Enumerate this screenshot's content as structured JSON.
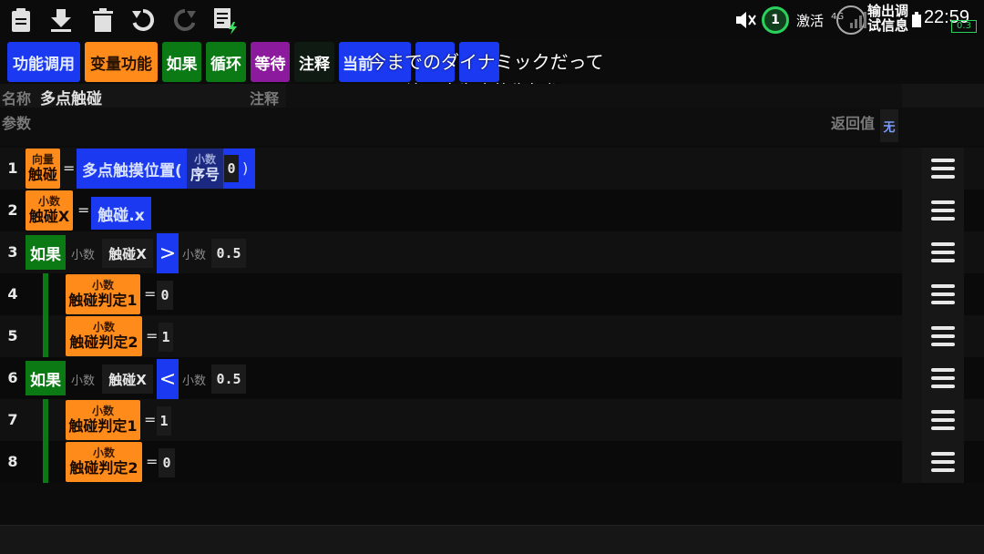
{
  "status_bar": {
    "badge": "1",
    "time": "22:59",
    "network": "4G",
    "left_label": "激活",
    "debug_label_1": "输出调",
    "debug_label_2": "试信息",
    "battery": "0.3"
  },
  "categories": [
    {
      "label": "功能调用",
      "color": "blue"
    },
    {
      "label": "变量功能",
      "color": "orange"
    },
    {
      "label": "如果",
      "color": "green"
    },
    {
      "label": "循环",
      "color": "green"
    },
    {
      "label": "等待",
      "color": "purple"
    },
    {
      "label": "注释",
      "color": "dark"
    },
    {
      "label": "当前",
      "color": "blue"
    },
    {
      "label": "",
      "color": "blue"
    },
    {
      "label": "",
      "color": "blue"
    }
  ],
  "overlay": {
    "line1": "今までのダイナミックだって",
    "line2": "连至今为止的生机都"
  },
  "meta": {
    "name_label": "名称",
    "name_value": "多点触碰",
    "comment_label": "注释",
    "params_label": "参数",
    "return_label": "返回值",
    "return_value": "无"
  },
  "rows": [
    {
      "num": "1",
      "var_type": "向量",
      "var_name": "触碰",
      "eq": "=",
      "func": "多点触摸位置(",
      "arg_type": "小数",
      "arg_name": "序号",
      "arg_value": "0",
      "close": ")"
    },
    {
      "num": "2",
      "var_type": "小数",
      "var_name": "触碰X",
      "eq": "=",
      "expr": "触碰.x"
    },
    {
      "num": "3",
      "if_label": "如果",
      "left_type": "小数",
      "left_name": "触碰X",
      "op": ">",
      "right_type": "小数",
      "right_value": "0.5"
    },
    {
      "num": "4",
      "var_type": "小数",
      "var_name": "触碰判定1",
      "eq": "=",
      "value": "0"
    },
    {
      "num": "5",
      "var_type": "小数",
      "var_name": "触碰判定2",
      "eq": "=",
      "value": "1"
    },
    {
      "num": "6",
      "if_label": "如果",
      "left_type": "小数",
      "left_name": "触碰X",
      "op": "<",
      "right_type": "小数",
      "right_value": "0.5"
    },
    {
      "num": "7",
      "var_type": "小数",
      "var_name": "触碰判定1",
      "eq": "=",
      "value": "1"
    },
    {
      "num": "8",
      "var_type": "小数",
      "var_name": "触碰判定2",
      "eq": "=",
      "value": "0"
    }
  ]
}
